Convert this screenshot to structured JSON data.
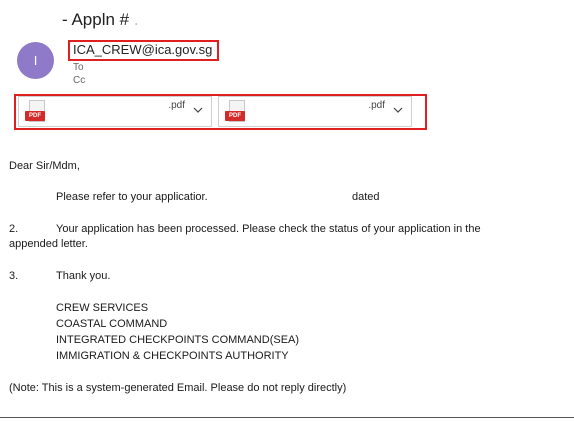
{
  "header": {
    "subject": "- Appln #",
    "subject_trail": "."
  },
  "sender": {
    "avatar_initial": "I",
    "email": "ICA_CREW@ica.gov.sg",
    "to_label": "To",
    "cc_label": "Cc"
  },
  "attachments": [
    {
      "icon_label": "PDF",
      "extension": ".pdf"
    },
    {
      "icon_label": "PDF",
      "extension": ".pdf"
    }
  ],
  "message": {
    "greeting": "Dear Sir/Mdm,",
    "para1": "Please refer to your applicatior.",
    "para1_dated": "dated",
    "para2_num": "2.",
    "para2_line1": "Your application has been processed. Please check the status of your application in the",
    "para2_line2": "appended letter.",
    "para3_num": "3.",
    "para3": "Thank you.",
    "signature": [
      "CREW SERVICES",
      "COASTAL COMMAND",
      "INTEGRATED CHECKPOINTS COMMAND(SEA)",
      "IMMIGRATION & CHECKPOINTS AUTHORITY"
    ],
    "note": "(Note: This is a system-generated Email. Please do not reply directly)"
  },
  "colors": {
    "avatar": "#8f79c9",
    "highlight_box": "#e02020",
    "pdf_badge": "#d42a2a"
  }
}
